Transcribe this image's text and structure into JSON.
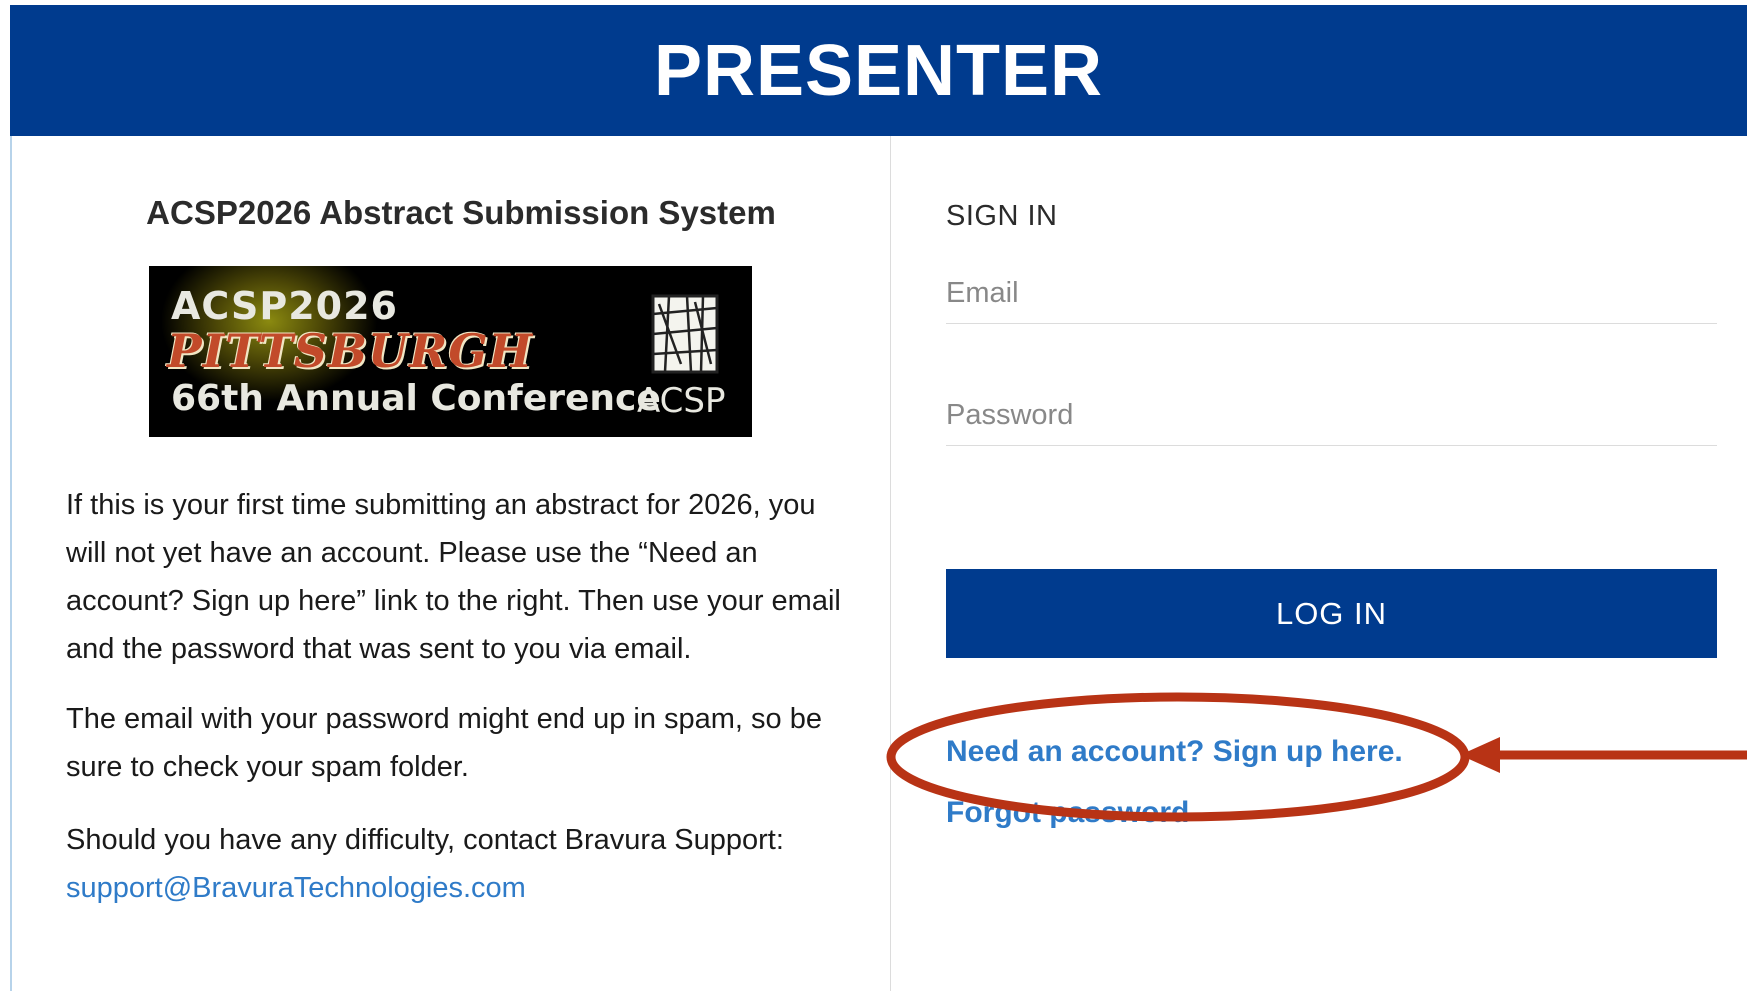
{
  "header": {
    "title": "PRESENTER"
  },
  "intro": {
    "system_title": "ACSP2026 Abstract Submission System",
    "banner": {
      "line1": "ACSP2026",
      "line2": "PITTSBURGH",
      "line3": "66th Annual Conference",
      "org": "ACSP"
    },
    "paragraphs": [
      "If this is your first time submitting an abstract for 2026, you will not yet have an account. Please use the “Need an account? Sign up here” link to the right. Then use your email and the password that was sent to you via email.",
      "The email with your password might end up in spam, so be sure to check your spam folder.",
      "Should you have any difficulty, contact Bravura Support:"
    ],
    "support_email": "support@BravuraTechnologies.com"
  },
  "signin": {
    "title": "SIGN IN",
    "email_placeholder": "Email",
    "password_placeholder": "Password",
    "login_label": "LOG IN",
    "signup_link": "Need an account? Sign up here.",
    "forgot_link": "Forgot password"
  },
  "colors": {
    "header_bg": "#003b8e",
    "link": "#2f7bc8",
    "annotation": "#b83315"
  }
}
